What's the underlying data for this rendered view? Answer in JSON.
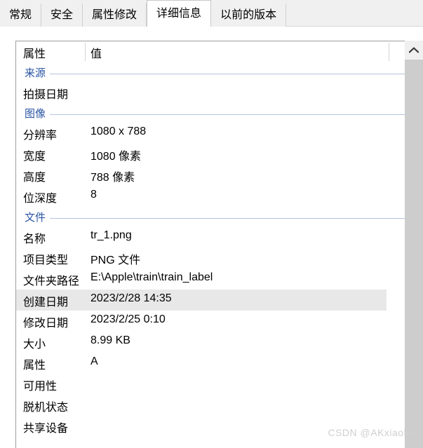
{
  "window": {
    "type": "file-properties-dialog"
  },
  "tabs": [
    {
      "label": "常规",
      "active": false
    },
    {
      "label": "安全",
      "active": false
    },
    {
      "label": "属性修改",
      "active": false
    },
    {
      "label": "详细信息",
      "active": true
    },
    {
      "label": "以前的版本",
      "active": false
    }
  ],
  "table": {
    "columns": {
      "property": "属性",
      "value": "值"
    },
    "rows": [
      {
        "kind": "section",
        "label": "来源"
      },
      {
        "kind": "data",
        "property": "拍摄日期",
        "value": "",
        "highlight": false
      },
      {
        "kind": "section",
        "label": "图像"
      },
      {
        "kind": "data",
        "property": "分辨率",
        "value": "1080 x 788",
        "highlight": false
      },
      {
        "kind": "data",
        "property": "宽度",
        "value": "1080 像素",
        "highlight": false
      },
      {
        "kind": "data",
        "property": "高度",
        "value": "788 像素",
        "highlight": false
      },
      {
        "kind": "data",
        "property": "位深度",
        "value": "8",
        "highlight": false
      },
      {
        "kind": "section",
        "label": "文件"
      },
      {
        "kind": "data",
        "property": "名称",
        "value": "tr_1.png",
        "highlight": false
      },
      {
        "kind": "data",
        "property": "项目类型",
        "value": "PNG 文件",
        "highlight": false
      },
      {
        "kind": "data",
        "property": "文件夹路径",
        "value": "E:\\Apple\\train\\train_label",
        "highlight": false
      },
      {
        "kind": "data",
        "property": "创建日期",
        "value": "2023/2/28 14:35",
        "highlight": true
      },
      {
        "kind": "data",
        "property": "修改日期",
        "value": "2023/2/25 0:10",
        "highlight": false
      },
      {
        "kind": "data",
        "property": "大小",
        "value": "8.99 KB",
        "highlight": false
      },
      {
        "kind": "data",
        "property": "属性",
        "value": "A",
        "highlight": false
      },
      {
        "kind": "data",
        "property": "可用性",
        "value": "",
        "highlight": false
      },
      {
        "kind": "data",
        "property": "脱机状态",
        "value": "",
        "highlight": false
      },
      {
        "kind": "data",
        "property": "共享设备",
        "value": "",
        "highlight": false
      }
    ]
  },
  "scrollbar": {
    "up_arrow_icon": "chevron-up-icon"
  },
  "watermark": {
    "text": "CSDN @AKxiaokui"
  },
  "colors": {
    "section_header": "#2a55a3",
    "section_line": "#b6c3de",
    "row_highlight": "#e8e8e8",
    "tab_strip_bg": "#f0f0f0",
    "scroll_thumb": "#cdcdcd",
    "watermark": "#cfcfcf"
  }
}
